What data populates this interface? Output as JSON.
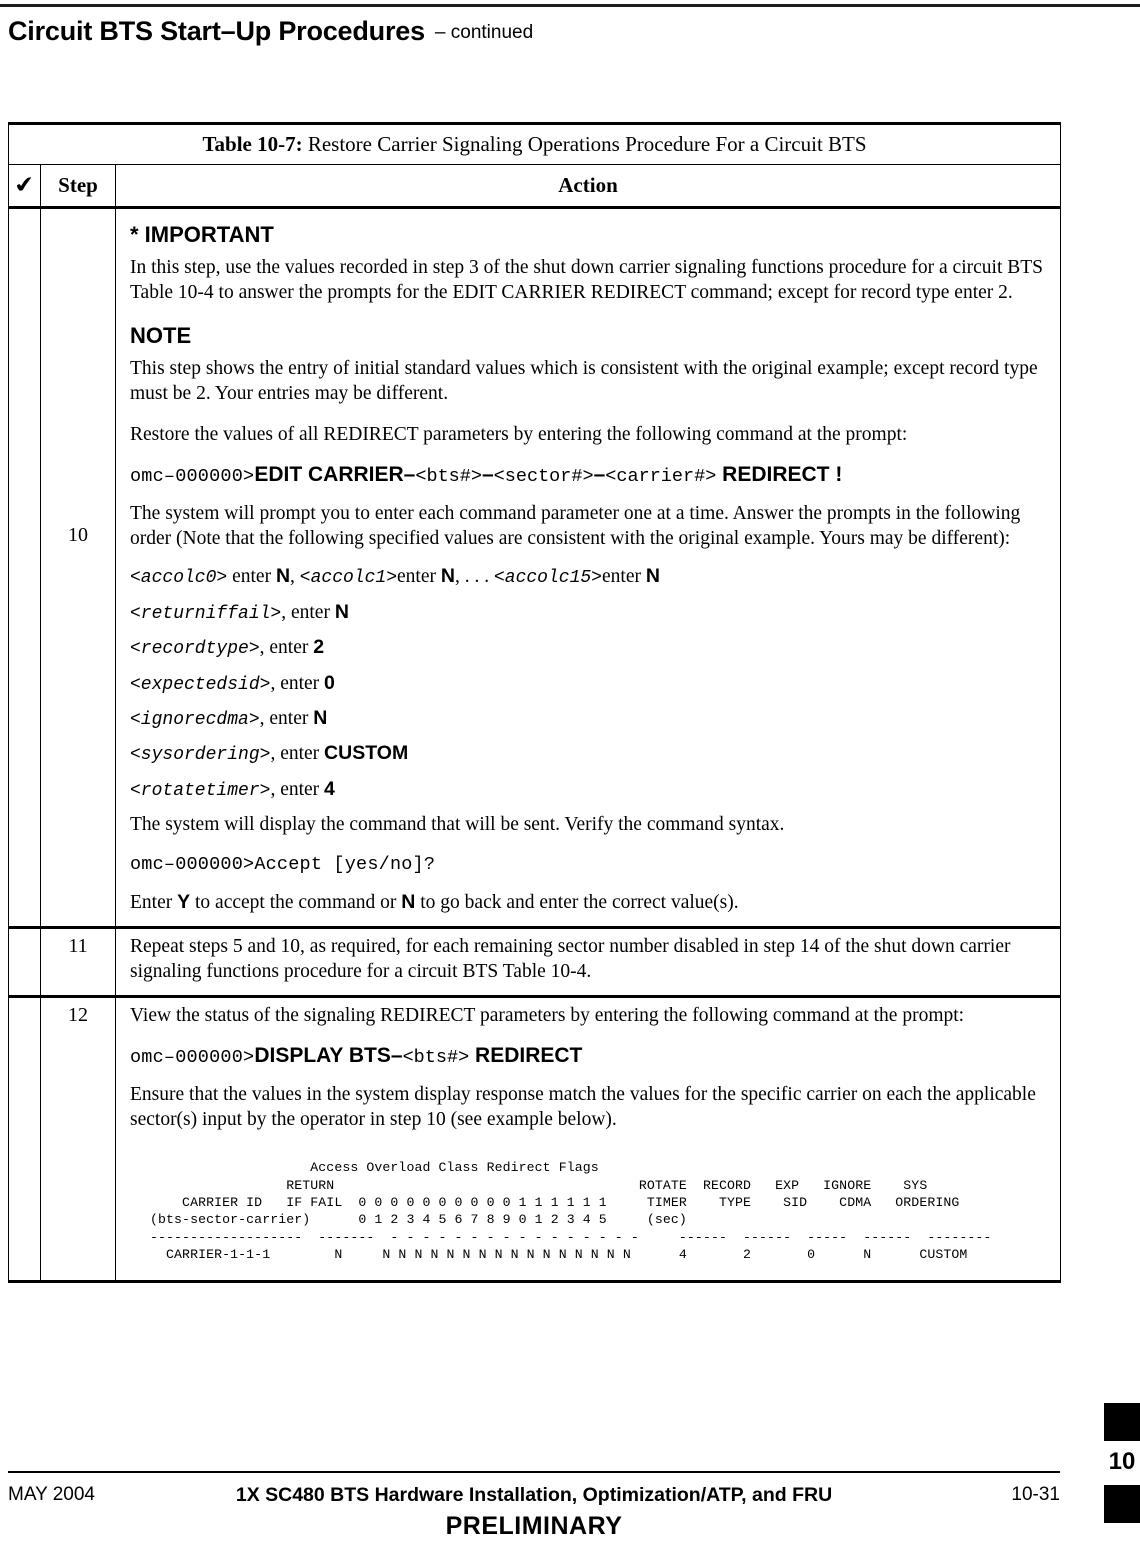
{
  "header": {
    "title": "Circuit BTS Start–Up Procedures",
    "continued": "– continued"
  },
  "table": {
    "caption_label": "Table 10-7:",
    "caption_text": " Restore Carrier Signaling Operations Procedure For a Circuit BTS",
    "columns": {
      "check": "✔",
      "step": "Step",
      "action": "Action"
    },
    "rows": [
      {
        "step": "10",
        "important_heading": "* IMPORTANT",
        "important_text": "In this step, use the values recorded in step 3 of the shut down carrier signaling functions procedure for a circuit BTS Table 10-4 to answer the prompts for the EDIT CARRIER REDIRECT command; except for record type enter 2.",
        "note_heading": "NOTE",
        "note_text": "This step shows the entry of initial standard values which is consistent with the original example; except record type must be 2. Your entries may be different.",
        "intro": "Restore the values of all REDIRECT parameters by entering the following command at the prompt:",
        "command": {
          "prompt": "omc–000000>",
          "verb": "EDIT CARRIER–",
          "arg1": "<bts#>",
          "sep1": "–",
          "arg2": "<sector#>",
          "sep2": "–",
          "arg3": "<carrier#>",
          "object": "REDIRECT !"
        },
        "prompt_order_text": "The system will prompt you to enter each command parameter one at a time. Answer the prompts in the following order (Note that the following specified values are consistent with the original example. Yours may be different):",
        "accolc_line": {
          "p0": "<accolc0>",
          "t0": " enter ",
          "v0": "N",
          "t1": ", ",
          "p1": "<accolc1>",
          "t2": "enter ",
          "v1": "N",
          "t3": ", . . .  ",
          "p2": "<accolc15>",
          "t4": "enter ",
          "v2": "N"
        },
        "params": [
          {
            "name": "<returniffail>",
            "mid": ", enter ",
            "value": "N"
          },
          {
            "name": "<recordtype>",
            "mid": ", enter ",
            "value": "2"
          },
          {
            "name": "<expectedsid>",
            "mid": ", enter ",
            "value": "0"
          },
          {
            "name": "<ignorecdma>",
            "mid": ", enter ",
            "value": "N"
          },
          {
            "name": "<sysordering>",
            "mid": ", enter ",
            "value": "CUSTOM"
          },
          {
            "name": "<rotatetimer>",
            "mid": ", enter ",
            "value": "4"
          }
        ],
        "verify_text": "The system will display the command that will be sent. Verify the command syntax.",
        "accept_prompt": "omc–000000>Accept [yes/no]?",
        "accept_line": {
          "a": "Enter ",
          "y": "Y",
          "b": " to accept the command or ",
          "n": "N",
          "c": " to go back and enter the correct value(s)."
        }
      },
      {
        "step": "11",
        "text": "Repeat steps 5 and 10, as required, for each remaining sector number disabled in step 14 of the shut down carrier signaling functions procedure for a circuit BTS Table 10-4."
      },
      {
        "step": "12",
        "intro": "View the status of the signaling REDIRECT parameters by entering the following command at the prompt:",
        "command": {
          "prompt": "omc–000000>",
          "verb": "DISPLAY BTS–",
          "arg1": "<bts#>",
          "object": "REDIRECT"
        },
        "ensure_text": "Ensure that the values in the system display response match the values for the specific carrier on each the applicable sector(s) input by the operator in step 10 (see example below).",
        "listing": "                    Access Overload Class Redirect Flags\n                 RETURN                                      ROTATE  RECORD   EXP   IGNORE    SYS\n    CARRIER ID   IF FAIL  0 0 0 0 0 0 0 0 0 0 1 1 1 1 1 1     TIMER    TYPE    SID    CDMA   ORDERING\n(bts-sector-carrier)      0 1 2 3 4 5 6 7 8 9 0 1 2 3 4 5     (sec)\n-------------------  -------  - - - - - - - - - - - - - - - -     ------  ------  -----  ------  --------\n  CARRIER-1-1-1        N     N N N N N N N N N N N N N N N N      4       2       0      N      CUSTOM"
      }
    ]
  },
  "footer": {
    "date": "MAY 2004",
    "title": "1X SC480 BTS Hardware Installation, Optimization/ATP, and FRU",
    "page": "10-31",
    "preliminary": "PRELIMINARY",
    "chapter_tab": "10"
  }
}
